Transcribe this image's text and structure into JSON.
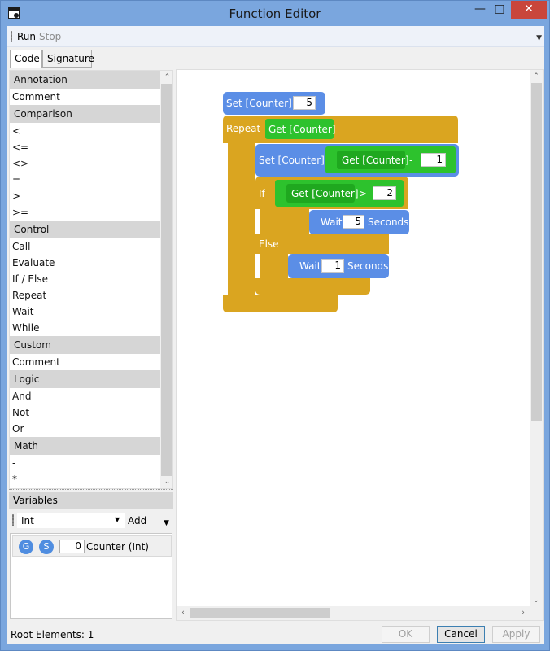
{
  "window": {
    "title": "Function Editor"
  },
  "toolbar": {
    "run": "Run",
    "stop": "Stop"
  },
  "tabs": [
    "Code",
    "Signature"
  ],
  "palette": {
    "categories": [
      {
        "name": "Annotation",
        "items": [
          "Comment"
        ]
      },
      {
        "name": "Comparison",
        "items": [
          "<",
          "<=",
          "<>",
          "=",
          ">",
          ">="
        ]
      },
      {
        "name": "Control",
        "items": [
          "Call",
          "Evaluate",
          "If / Else",
          "Repeat",
          "Wait",
          "While"
        ]
      },
      {
        "name": "Custom",
        "items": [
          "Comment"
        ]
      },
      {
        "name": "Logic",
        "items": [
          "And",
          "Not",
          "Or"
        ]
      },
      {
        "name": "Math",
        "items": [
          "-",
          "*"
        ]
      }
    ]
  },
  "variables": {
    "header": "Variables",
    "type_selected": "Int",
    "add_label": "Add",
    "items": [
      {
        "get": "G",
        "set": "S",
        "value": "0",
        "name": "Counter (Int)"
      }
    ]
  },
  "code": {
    "set_block": {
      "label": "Set [Counter]",
      "value": "5"
    },
    "repeat": {
      "label": "Repeat",
      "condition": "Get [Counter]"
    },
    "inner_set": {
      "label": "Set [Counter]",
      "get": "Get [Counter]",
      "op": "-",
      "value": "1"
    },
    "if": {
      "label": "If",
      "get": "Get [Counter]",
      "op": ">",
      "value": "2"
    },
    "wait1": {
      "label": "Wait",
      "value": "5",
      "unit": "Seconds"
    },
    "else": {
      "label": "Else"
    },
    "wait2": {
      "label": "Wait",
      "value": "1",
      "unit": "Seconds"
    }
  },
  "status": {
    "root_elements": "Root Elements:  1"
  },
  "buttons": {
    "ok": "OK",
    "cancel": "Cancel",
    "apply": "Apply"
  },
  "colors": {
    "statement_blue": "#5b8ee6",
    "control_gold": "#daa520",
    "expression_green": "#2dc22d"
  }
}
